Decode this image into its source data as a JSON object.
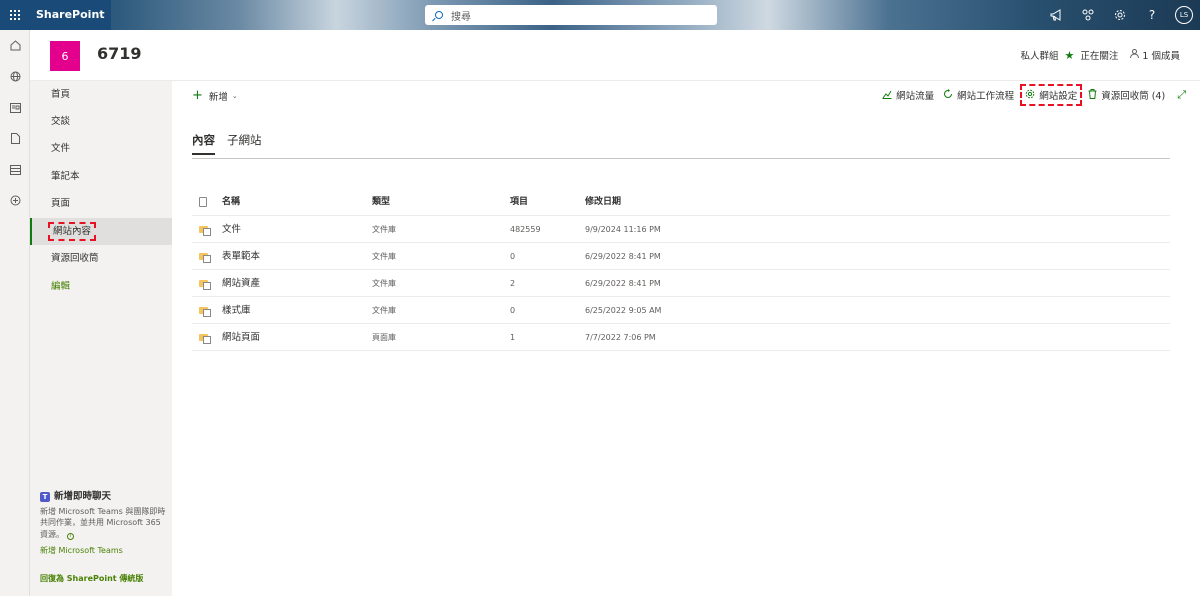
{
  "suite": {
    "brand": "SharePoint",
    "search_placeholder": "搜尋",
    "avatar_initials": "LS",
    "icons": [
      "megaphone-icon",
      "connections-icon",
      "settings-icon",
      "help-icon"
    ],
    "help_glyph": "?"
  },
  "site": {
    "logo_letter": "6",
    "logo_color": "#e3008c",
    "title": "6719",
    "group_type": "私人群組",
    "following": "正在關注",
    "members": "1 個成員"
  },
  "leftnav": {
    "items": [
      {
        "label": "首頁"
      },
      {
        "label": "交談"
      },
      {
        "label": "文件"
      },
      {
        "label": "筆記本"
      },
      {
        "label": "頁面"
      },
      {
        "label": "網站內容"
      },
      {
        "label": "資源回收筒"
      },
      {
        "label": "編輯"
      }
    ],
    "selected_index": 5,
    "teams": {
      "title": "新增即時聊天",
      "body": "新增 Microsoft Teams 與團隊即時共同作業，並共用 Microsoft 365 資源。",
      "link": "新增 Microsoft Teams"
    },
    "classic_link": "回復為 SharePoint 傳統版"
  },
  "commandbar": {
    "new_label": "新增",
    "site_usage": "網站流量",
    "site_workflows": "網站工作流程",
    "site_settings": "網站設定",
    "recycle_bin": "資源回收筒 (4)"
  },
  "tabs": [
    {
      "label": "內容",
      "active": true
    },
    {
      "label": "子網站",
      "active": false
    }
  ],
  "table": {
    "columns": {
      "name": "名稱",
      "type": "類型",
      "items": "項目",
      "modified": "修改日期"
    },
    "rows": [
      {
        "name": "文件",
        "type": "文件庫",
        "items": "482559",
        "modified": "9/9/2024 11:16 PM"
      },
      {
        "name": "表單範本",
        "type": "文件庫",
        "items": "0",
        "modified": "6/29/2022 8:41 PM"
      },
      {
        "name": "網站資產",
        "type": "文件庫",
        "items": "2",
        "modified": "6/29/2022 8:41 PM"
      },
      {
        "name": "樣式庫",
        "type": "文件庫",
        "items": "0",
        "modified": "6/25/2022 9:05 AM"
      },
      {
        "name": "網站頁面",
        "type": "頁面庫",
        "items": "1",
        "modified": "7/7/2022 7:06 PM"
      }
    ]
  },
  "colors": {
    "accent_green": "#107c10",
    "highlight_red": "#e81123",
    "suite_blue": "#1a4b78"
  }
}
